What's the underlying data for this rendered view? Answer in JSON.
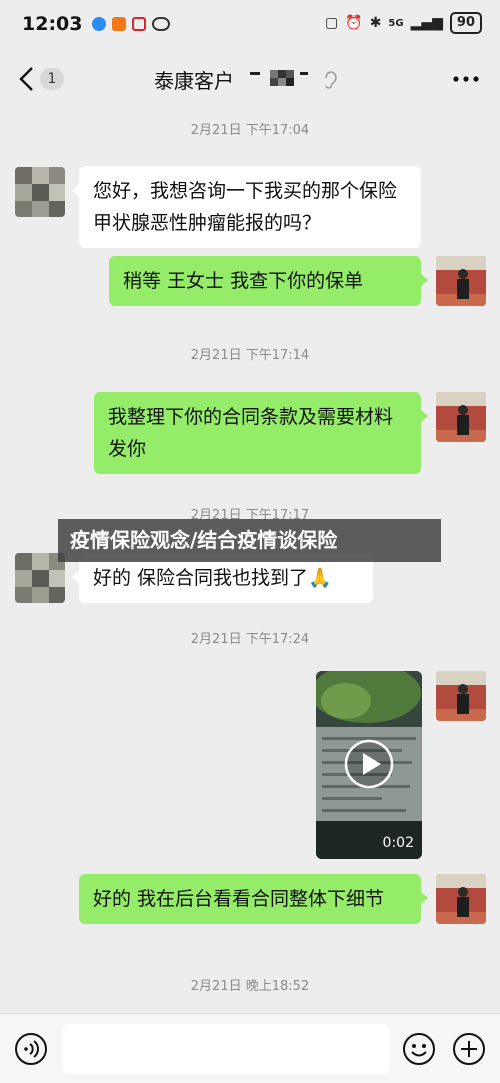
{
  "status_bar": {
    "time": "12:03",
    "network": "5G",
    "battery": "90"
  },
  "header": {
    "unread_count": "1",
    "title": "泰康客户"
  },
  "messages": [
    {
      "type": "timestamp",
      "text": "2月21日 下午17:04"
    },
    {
      "type": "text",
      "side": "left",
      "text": "您好，我想咨询一下我买的那个保险甲状腺恶性肿瘤能报的吗？"
    },
    {
      "type": "text",
      "side": "right",
      "text": "稍等   王女士  我查下你的保单"
    },
    {
      "type": "timestamp",
      "text": "2月21日 下午17:14"
    },
    {
      "type": "text",
      "side": "right",
      "text": "我整理下你的合同条款及需要材料  发你"
    },
    {
      "type": "timestamp",
      "text": "2月21日 下午17:17"
    },
    {
      "type": "text",
      "side": "left",
      "text": "好的 保险合同我也找到了🙏"
    },
    {
      "type": "timestamp",
      "text": "2月21日 下午17:24"
    },
    {
      "type": "video",
      "side": "right",
      "duration": "0:02"
    },
    {
      "type": "text",
      "side": "right",
      "text": "好的 我在后台看看合同整体下细节"
    },
    {
      "type": "timestamp",
      "text": "2月21日 晚上18:52"
    }
  ],
  "banner": {
    "text": "疫情保险观念/结合疫情谈保险"
  },
  "input_bar": {
    "value": "",
    "voice_icon": "voice-icon",
    "emoji_icon": "emoji-icon",
    "plus_icon": "plus-icon"
  },
  "colors": {
    "background": "#ededed",
    "sent_bubble": "#95ec69",
    "received_bubble": "#ffffff"
  }
}
